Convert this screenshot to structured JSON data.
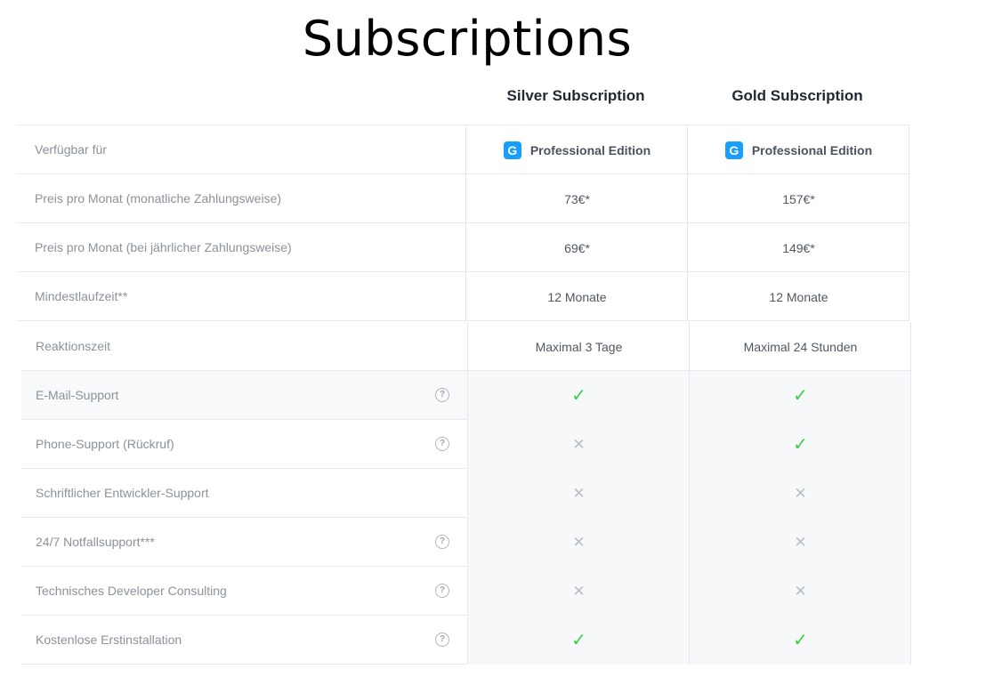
{
  "page": {
    "title": "Subscriptions"
  },
  "plans": [
    {
      "name": "Silver Subscription"
    },
    {
      "name": "Gold Subscription"
    }
  ],
  "edition": {
    "icon": "shopware-logo-icon",
    "name": "Professional Edition",
    "accent": "#189eff"
  },
  "rows_top": [
    {
      "label": "Verfügbar für",
      "silver": "Professional Edition",
      "gold": "Professional Edition"
    },
    {
      "label": "Preis pro Monat (monatliche Zahlungsweise)",
      "silver": "73€*",
      "gold": "157€*"
    },
    {
      "label": "Preis pro Monat (bei jährlicher Zahlungsweise)",
      "silver": "69€*",
      "gold": "149€*"
    },
    {
      "label": "Mindestlaufzeit**",
      "silver": "12 Monate",
      "gold": "12 Monate"
    }
  ],
  "rows_bottom": [
    {
      "label": "Reaktionszeit",
      "silver": "Maximal 3 Tage",
      "gold": "Maximal 24 Stunden"
    },
    {
      "label": "E-Mail-Support",
      "help": true,
      "silver": true,
      "gold": true
    },
    {
      "label": "Phone-Support (Rückruf)",
      "help": true,
      "silver": false,
      "gold": true
    },
    {
      "label": "Schriftlicher Entwickler-Support",
      "help": false,
      "silver": false,
      "gold": false
    },
    {
      "label": "24/7 Notfallsupport***",
      "help": true,
      "silver": false,
      "gold": false
    },
    {
      "label": "Technisches Developer Consulting",
      "help": true,
      "silver": false,
      "gold": false
    },
    {
      "label": "Kostenlose Erstinstallation",
      "help": true,
      "silver": true,
      "gold": true
    }
  ],
  "symbols": {
    "check": "✓",
    "cross": "✕",
    "help": "?"
  },
  "colors": {
    "check": "#37d046",
    "cross": "#b8bec5"
  }
}
